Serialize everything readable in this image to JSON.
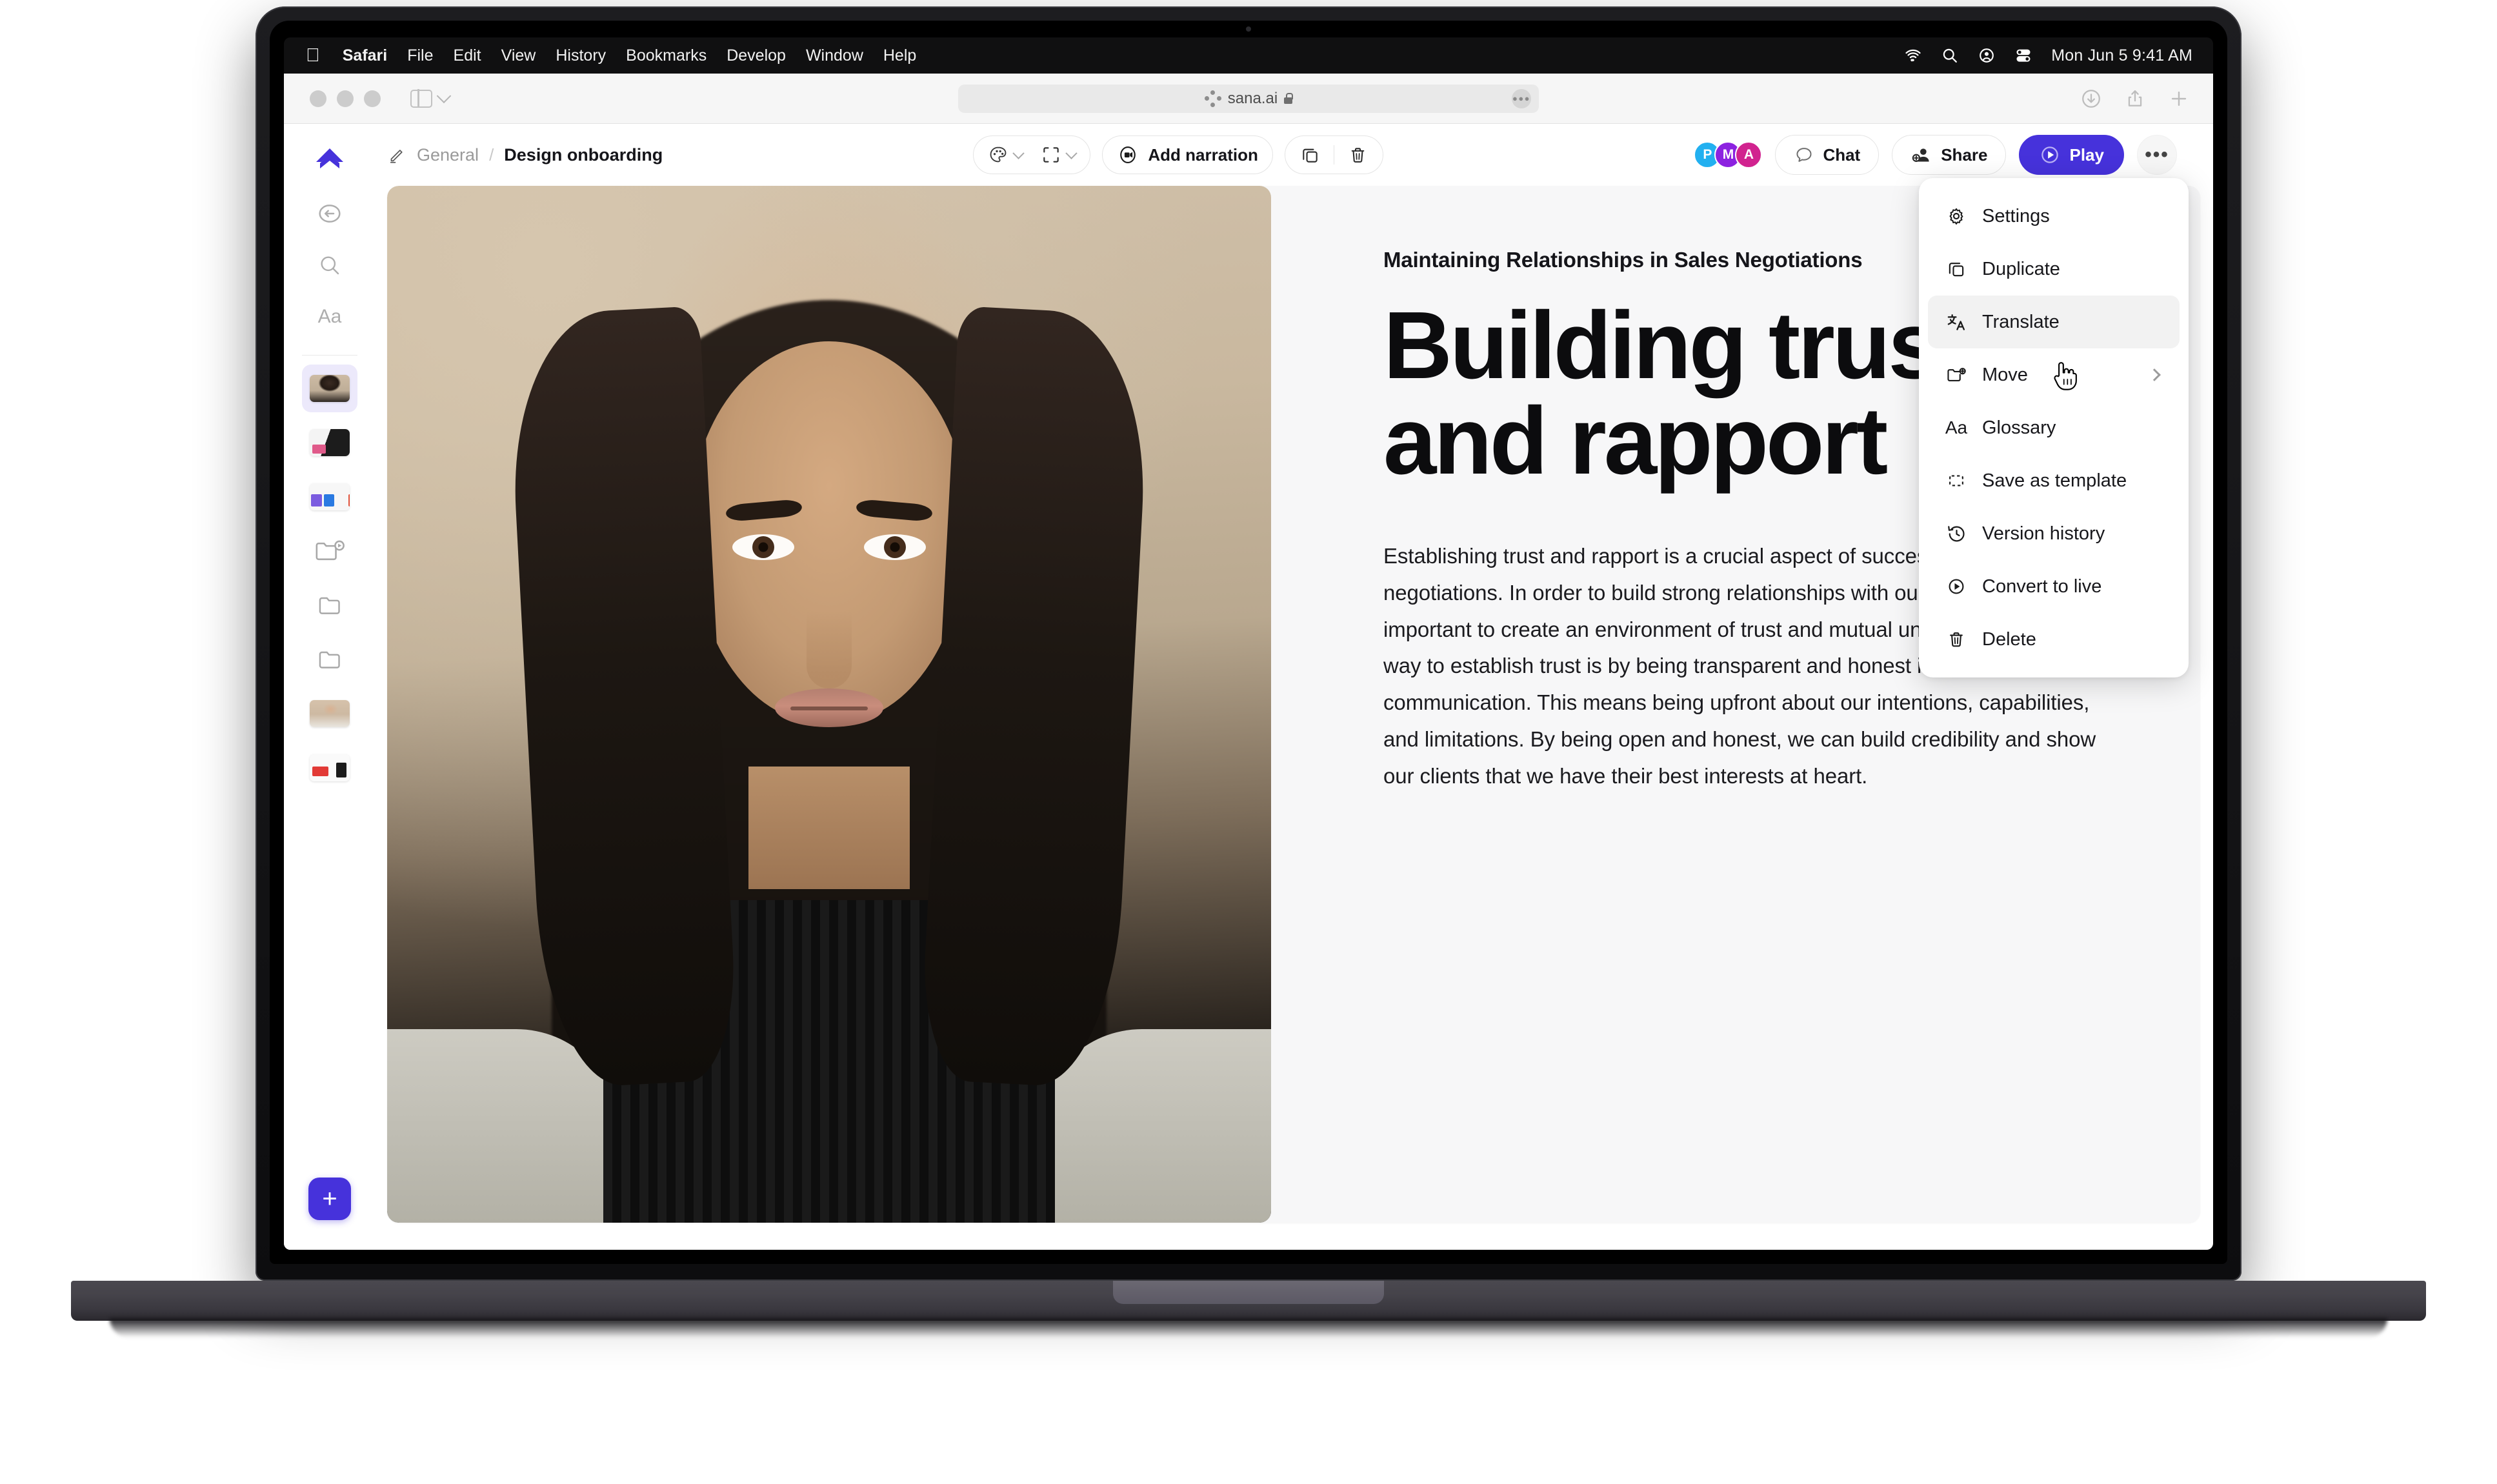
{
  "macos": {
    "menu_items": [
      "Safari",
      "File",
      "Edit",
      "View",
      "History",
      "Bookmarks",
      "Develop",
      "Window",
      "Help"
    ],
    "apple_logo": "apple-logo",
    "status_icons": [
      "wifi-icon",
      "search-icon",
      "control-center-icon",
      "toggle-icon"
    ],
    "clock": "Mon Jun 5  9:41 AM"
  },
  "safari": {
    "url": "sana.ai",
    "url_lock": "lock-icon",
    "site_favicon": "sana-dots-icon",
    "sidebar_toggle": "sidebar-toggle-icon",
    "tabs_chevron": "chevron-down-icon",
    "right_icons": [
      "downloads-icon",
      "share-icon",
      "new-tab-icon"
    ],
    "reload_label": "●●●"
  },
  "app": {
    "sidebar": {
      "logo": "sana-logo",
      "tools": [
        {
          "name": "back-history-icon"
        },
        {
          "name": "search-icon"
        },
        {
          "name": "text-format-icon",
          "label": "Aa"
        }
      ],
      "slides": [
        {
          "name": "slide-thumb-portrait",
          "selected": true
        },
        {
          "name": "slide-thumb-dark",
          "selected": false
        },
        {
          "name": "slide-thumb-color",
          "selected": false
        },
        {
          "name": "folder-play-icon",
          "selected": false
        },
        {
          "name": "folder-icon",
          "selected": false
        },
        {
          "name": "folder-icon-2",
          "selected": false
        },
        {
          "name": "slide-thumb-portrait-2",
          "selected": false
        },
        {
          "name": "slide-thumb-slide",
          "selected": false
        }
      ],
      "add_label": "+"
    },
    "header": {
      "edit_icon": "pencil-icon",
      "breadcrumb_root": "General",
      "breadcrumb_separator": "/",
      "breadcrumb_current": "Design onboarding",
      "theme_icon": "palette-icon",
      "layout_icon": "frame-icon",
      "narration_icon": "record-video-icon",
      "narration_label": "Add narration",
      "duplicate_icon": "duplicate-icon",
      "delete_icon": "trash-icon",
      "avatars": [
        {
          "initial": "P",
          "color": "#22b0f0"
        },
        {
          "initial": "M",
          "color": "#8c22e0"
        },
        {
          "initial": "A",
          "color": "#d1238f"
        }
      ],
      "chat_icon": "chat-bubble-icon",
      "chat_label": "Chat",
      "share_icon": "share-person-icon",
      "share_label": "Share",
      "play_icon": "play-circle-icon",
      "play_label": "Play",
      "play_color": "#4632db",
      "more_label": "•••"
    },
    "slide": {
      "photo_alt": "portrait-photo",
      "eyebrow": "Maintaining Relationships in Sales Negotiations",
      "title": "Building trust and rapport",
      "body": "Establishing trust and rapport is a crucial aspect of successful sales negotiations. In order to build strong relationships with our clients, it is important to create an environment of trust and mutual understanding. One way to establish trust is by being transparent and honest in our communication. This means being upfront about our intentions, capabilities, and limitations. By being open and honest, we can build credibility and show our clients that we have their best interests at heart."
    },
    "dropdown": {
      "items": [
        {
          "label": "Settings",
          "icon": "gear-icon",
          "hovered": false,
          "submenu": false
        },
        {
          "label": "Duplicate",
          "icon": "duplicate-icon",
          "hovered": false,
          "submenu": false
        },
        {
          "label": "Translate",
          "icon": "translate-icon",
          "hovered": true,
          "submenu": false
        },
        {
          "label": "Move",
          "icon": "folder-move-icon",
          "hovered": false,
          "submenu": true
        },
        {
          "label": "Glossary",
          "icon": "aa-icon",
          "hovered": false,
          "submenu": false
        },
        {
          "label": "Save as template",
          "icon": "dashed-square-icon",
          "hovered": false,
          "submenu": false
        },
        {
          "label": "Version history",
          "icon": "history-clock-icon",
          "hovered": false,
          "submenu": false
        },
        {
          "label": "Convert to live",
          "icon": "play-circle-icon",
          "hovered": false,
          "submenu": false
        },
        {
          "label": "Delete",
          "icon": "trash-icon",
          "hovered": false,
          "submenu": false
        }
      ]
    },
    "cursor": "pointing-hand-cursor"
  }
}
